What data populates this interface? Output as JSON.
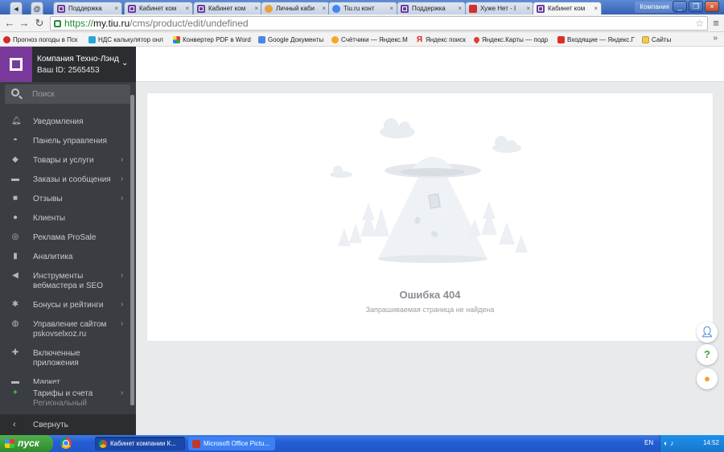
{
  "browser": {
    "tabs": [
      {
        "label": "Поддержка",
        "icon": "purple-square-icon"
      },
      {
        "label": "Кабинет ком",
        "icon": "purple-square-icon"
      },
      {
        "label": "Кабинет ком",
        "icon": "purple-square-icon"
      },
      {
        "label": "Личный каби",
        "icon": "people-icon"
      },
      {
        "label": "Tiu.ru конт",
        "icon": "google-icon"
      },
      {
        "label": "Поддержка",
        "icon": "purple-square-icon"
      },
      {
        "label": "Хуже Нет - I",
        "icon": "red-x-icon"
      },
      {
        "label": "Кабинет ком",
        "icon": "purple-square-icon"
      }
    ],
    "user_label": "Компания",
    "url": {
      "scheme": "https://",
      "host": "my.tiu.ru",
      "path": "/cms/product/edit/undefined"
    },
    "bookmarks": [
      "Прогноз погоды в Пск",
      "НДС калькулятор онл",
      "Конвертер PDF в Word",
      "Google Документы",
      "Счётчики — Яндекс.М",
      "Яндекс поиск",
      "Яндекс.Карты — подр",
      "Входящие — Яндекс.Г",
      "Сайты"
    ]
  },
  "sidebar": {
    "company_name": "Компания Техно-Лэнд",
    "company_id": "Ваш ID: 2565453",
    "search_placeholder": "Поиск",
    "items": [
      {
        "label": "Уведомления",
        "icon": "bell-icon"
      },
      {
        "label": "Панель управления",
        "icon": "dashboard-icon"
      },
      {
        "label": "Товары и услуги",
        "icon": "tag-icon"
      },
      {
        "label": "Заказы и сообщения",
        "icon": "cart-icon"
      },
      {
        "label": "Отзывы",
        "icon": "comment-icon"
      },
      {
        "label": "Клиенты",
        "icon": "users-icon"
      },
      {
        "label": "Реклама ProSale",
        "icon": "target-icon"
      },
      {
        "label": "Аналитика",
        "icon": "bar-chart-icon"
      },
      {
        "label": "Инструменты",
        "label2": "вебмастера и SEO",
        "icon": "megaphone-icon"
      },
      {
        "label": "Бонусы и рейтинги",
        "icon": "gear-icon"
      },
      {
        "label": "Управление сайтом",
        "label2": "pskovselxoz.ru",
        "icon": "globe-icon"
      },
      {
        "label": "Включенные",
        "label2": "приложения",
        "icon": "puzzle-icon"
      },
      {
        "label": "Маркет",
        "icon": "market-icon"
      },
      {
        "label": "Тарифы и счета",
        "label2": "Региональный",
        "icon": "tariff-icon"
      }
    ],
    "collapse_label": "Свернуть"
  },
  "error": {
    "title": "Ошибка 404",
    "subtitle": "Запрашиваемая страница не найдена"
  },
  "taskbar": {
    "start_label": "пуск",
    "tasks": [
      "Кабинет компании К...",
      "Microsoft Office Pictu..."
    ],
    "lang": "EN",
    "clock": "14:52"
  }
}
